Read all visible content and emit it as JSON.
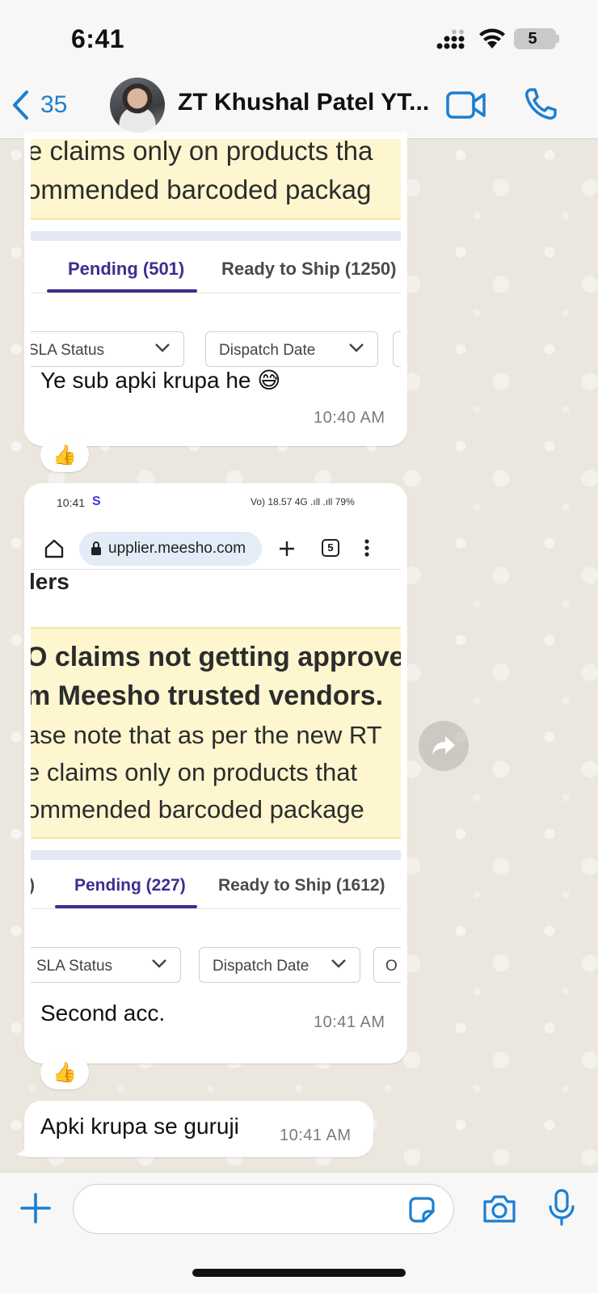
{
  "status_bar": {
    "time": "6:41",
    "battery": "5",
    "battery_level": 0.05
  },
  "header": {
    "back_count": "35",
    "contact_name": "ZT Khushal Patel YT...",
    "video_icon": "video-camera-icon",
    "call_icon": "phone-icon"
  },
  "messages": [
    {
      "screenshot": {
        "notice_lines": [
          "e claims only on products tha",
          "ommended barcoded packag"
        ],
        "tabs": [
          {
            "label": "Pending (501)",
            "active": true
          },
          {
            "label": "Ready to Ship (1250)",
            "active": false
          }
        ],
        "filters": [
          "SLA Status",
          "Dispatch Date"
        ]
      },
      "caption": "Ye sub apki krupa he 😅",
      "time": "10:40 AM",
      "reaction": "👍"
    },
    {
      "screenshot": {
        "status_time": "10:41",
        "status_s": "S",
        "status_right": "Vo) 18.57 4G .ıll .ıll 79%",
        "url": "upplier.meesho.com",
        "tab_count": "5",
        "heading": "lers",
        "notice_lines": [
          "O claims not getting approve",
          "m Meesho trusted vendors.",
          "ase note that as per the new RT",
          "e claims only on products that",
          "ommended barcoded package"
        ],
        "tabs": [
          {
            "label": ")",
            "active": false
          },
          {
            "label": "Pending (227)",
            "active": true
          },
          {
            "label": "Ready to Ship (1612)",
            "active": false
          }
        ],
        "filters": [
          "SLA Status",
          "Dispatch Date",
          "O"
        ]
      },
      "caption": "Second acc.",
      "time": "10:41 AM",
      "reaction": "👍"
    },
    {
      "text": "Apki krupa se guruji",
      "time": "10:41 AM"
    }
  ],
  "input": {
    "placeholder": ""
  },
  "colors": {
    "accent": "#1b7fd1",
    "tab_active": "#3b2f8f",
    "notice_bg": "#fdf6cf"
  }
}
